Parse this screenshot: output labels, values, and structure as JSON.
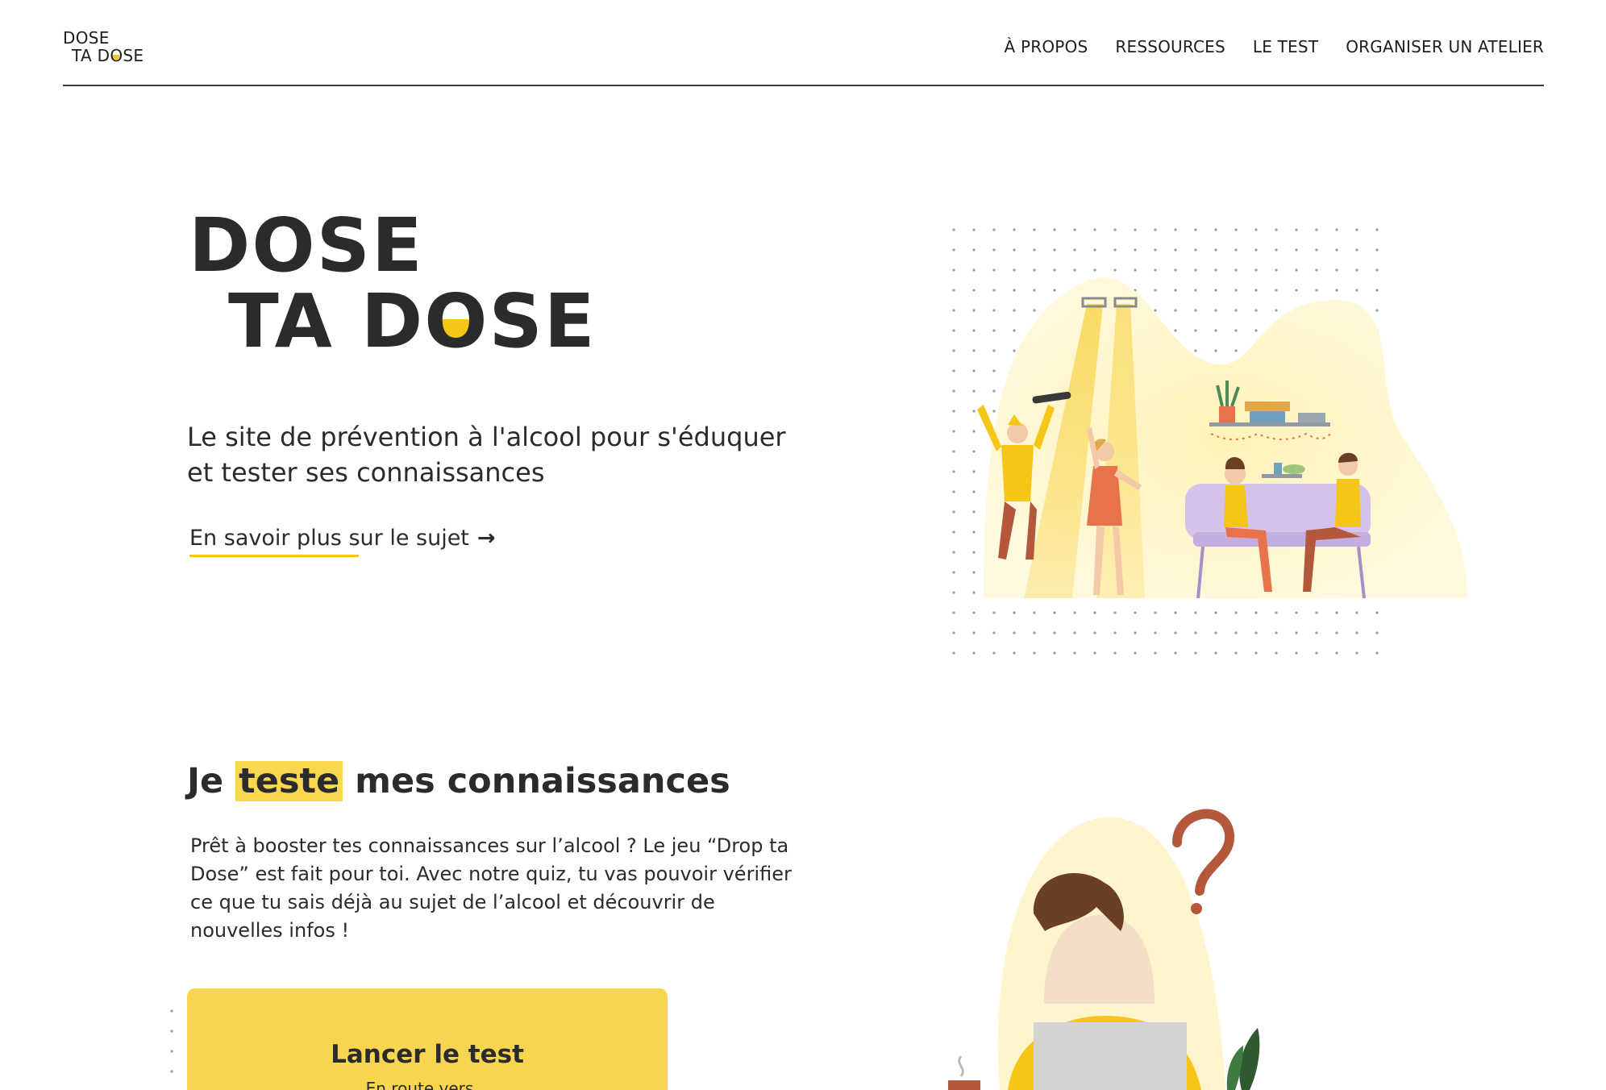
{
  "header": {
    "logo_line1": "DOSE",
    "logo_line2_a": "TA D",
    "logo_line2_o": "O",
    "logo_line2_b": "SE",
    "nav": [
      {
        "label": "À PROPOS"
      },
      {
        "label": "RESSOURCES"
      },
      {
        "label": "LE TEST"
      },
      {
        "label": "ORGANISER UN ATELIER"
      }
    ]
  },
  "hero": {
    "logo_line1": "DOSE",
    "logo_line2_a": "TA D",
    "logo_line2_o": "O",
    "logo_line2_b": "SE",
    "subtitle": "Le site de prévention à l'alcool pour s'éduquer et tester ses connaissances",
    "link_label": "En savoir plus sur le sujet",
    "link_arrow": "→"
  },
  "quiz_section": {
    "title_before": "Je ",
    "title_highlight": "teste",
    "title_after": " mes connaissances",
    "text": "Prêt à booster tes connaissances sur l’alcool ? Le jeu “Drop ta Dose” est fait pour toi. Avec notre quiz, tu vas pouvoir vérifier ce que tu sais déjà au sujet de l’alcool et découvrir de nouvelles infos !",
    "cta_label": "Lancer le test",
    "cta_sub": "En route vers..."
  },
  "colors": {
    "accent": "#f5c518",
    "button": "#f8d54f",
    "text": "#2b2b2b"
  }
}
